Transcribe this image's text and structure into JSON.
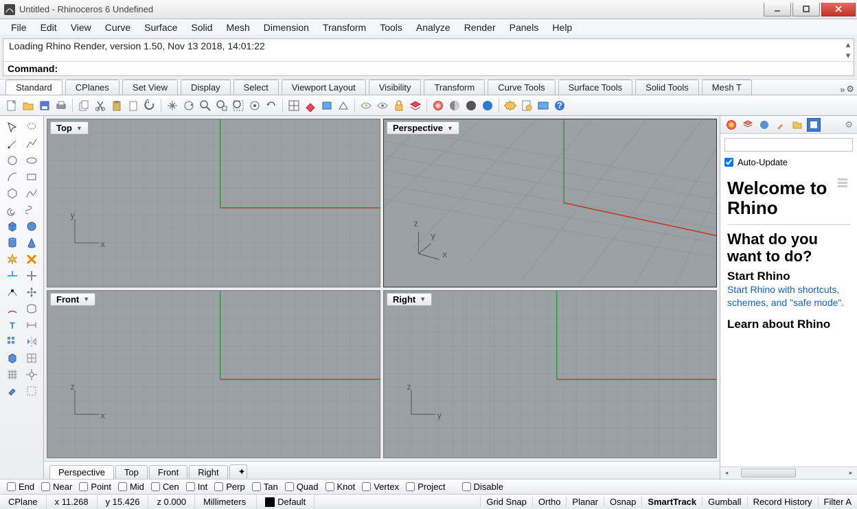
{
  "window": {
    "title": "Untitled - Rhinoceros 6 Undefined"
  },
  "menu": [
    "File",
    "Edit",
    "View",
    "Curve",
    "Surface",
    "Solid",
    "Mesh",
    "Dimension",
    "Transform",
    "Tools",
    "Analyze",
    "Render",
    "Panels",
    "Help"
  ],
  "console": {
    "line": "Loading Rhino Render, version 1.50, Nov 13 2018, 14:01:22",
    "prompt": "Command:"
  },
  "tooltabs": [
    "Standard",
    "CPlanes",
    "Set View",
    "Display",
    "Select",
    "Viewport Layout",
    "Visibility",
    "Transform",
    "Curve Tools",
    "Surface Tools",
    "Solid Tools",
    "Mesh T"
  ],
  "viewports": {
    "tl": {
      "title": "Top",
      "axes": [
        "x",
        "y"
      ]
    },
    "tr": {
      "title": "Perspective",
      "axes": [
        "x",
        "y",
        "z"
      ]
    },
    "bl": {
      "title": "Front",
      "axes": [
        "x",
        "z"
      ]
    },
    "br": {
      "title": "Right",
      "axes": [
        "y",
        "z"
      ]
    }
  },
  "viewtabs": [
    "Perspective",
    "Top",
    "Front",
    "Right"
  ],
  "rightpanel": {
    "auto_update": "Auto-Update",
    "h1": "Welcome to Rhino",
    "h2": "What do you want to do?",
    "start_h": "Start Rhino",
    "start_link": "Start Rhino with shortcuts, schemes, and \"safe mode\".",
    "learn_h": "Learn about Rhino"
  },
  "osnap": [
    "End",
    "Near",
    "Point",
    "Mid",
    "Cen",
    "Int",
    "Perp",
    "Tan",
    "Quad",
    "Knot",
    "Vertex",
    "Project",
    "Disable"
  ],
  "status": {
    "cplane": "CPlane",
    "x": "x 11.268",
    "y": "y 15.426",
    "z": "z 0.000",
    "units": "Millimeters",
    "layer": "Default",
    "toggles": [
      "Grid Snap",
      "Ortho",
      "Planar",
      "Osnap",
      "SmartTrack",
      "Gumball",
      "Record History",
      "Filter A"
    ]
  }
}
